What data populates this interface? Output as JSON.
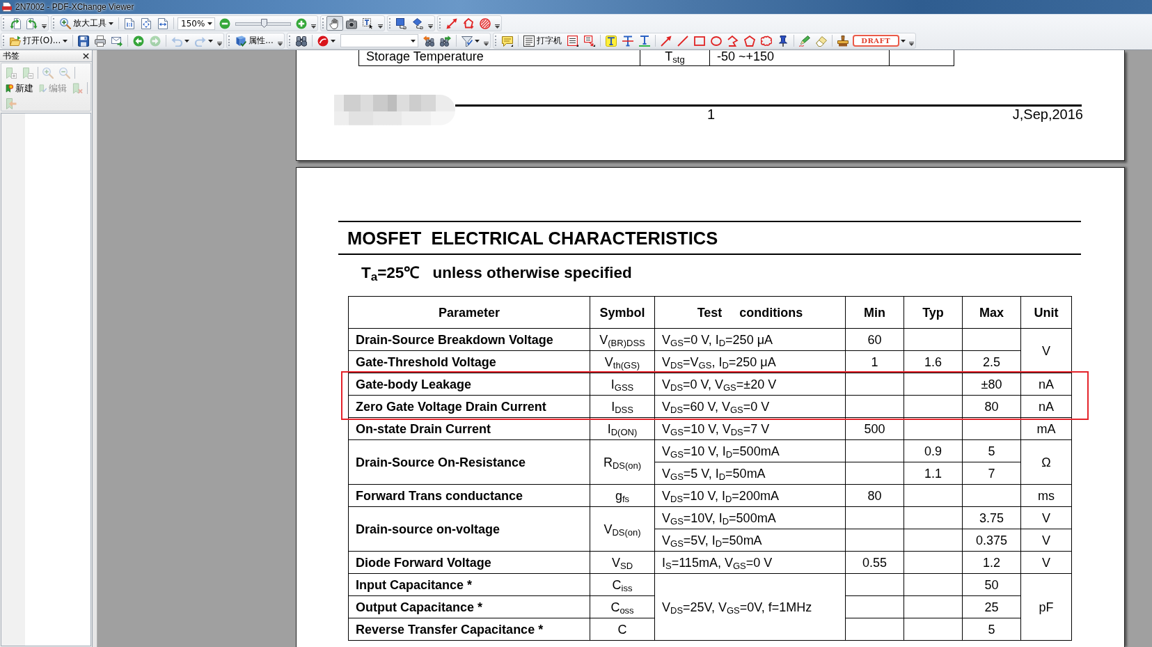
{
  "window": {
    "title": "2N7002 - PDF-XChange Viewer"
  },
  "toolbar_1": {
    "zoom_tool": {
      "label": "放大工具"
    },
    "zoom_box": {
      "value": "150%"
    },
    "zoom_slider": {
      "level": 0.52
    },
    "tools": [
      {
        "selected": true
      },
      {
        "selected": false
      },
      {
        "selected": false
      }
    ]
  },
  "toolbar_2": {
    "open_button": {
      "label": "打开(O)..."
    },
    "history": [
      {
        "disabled": false
      },
      {
        "disabled": true
      },
      {
        "disabled": true
      },
      {
        "disabled": true
      }
    ],
    "properties_button": {
      "label": "属性..."
    },
    "typewriter_button": {
      "label": "打字机"
    },
    "stamp_button": {
      "label": "DRAFT"
    }
  },
  "bookmarks_panel": {
    "title": "书签",
    "tool_buttons": [
      {
        "disabled": true
      },
      {
        "disabled": true
      },
      {
        "disabled": true
      },
      {
        "disabled": true
      }
    ],
    "bookmark_buttons": [
      {
        "label": "新建",
        "disabled": false
      },
      {
        "label": "编辑",
        "disabled": true
      }
    ],
    "extra_buttons": [
      {
        "disabled": true
      },
      {
        "disabled": true
      }
    ]
  },
  "document": {
    "page_1": {
      "table": {
        "rows": [
          {
            "highlighted": false,
            "cells": [
              {
                "kind": "text",
                "text": "Storage Temperature"
              },
              {
                "kind": "text",
                "text": "T$_{stg}$"
              },
              {
                "kind": "text",
                "text": "-50 ~+150"
              },
              {
                "kind": "blank"
              }
            ]
          }
        ]
      },
      "footer": {
        "page_number": "1",
        "date": "J,Sep,2016"
      }
    },
    "page_2": {
      "heading": "MOSFET  ELECTRICAL CHARACTERISTICS",
      "condition": "T$_{a}$=25℃",
      "condition_note": "unless otherwise specified",
      "table": {
        "columns": [
          "Parameter",
          "Symbol",
          "Test     conditions",
          "Min",
          "Typ",
          "Max",
          "Unit"
        ],
        "rows": [
          {
            "highlighted": false,
            "cells": [
              {
                "kind": "text",
                "text": "Drain-Source Breakdown Voltage"
              },
              {
                "kind": "text",
                "text": "V$_{(BR)DSS}$"
              },
              {
                "kind": "text",
                "text": "V$_{GS}$=0 V, I$_{D}$=250 μA"
              },
              {
                "kind": "text",
                "text": "60"
              },
              {
                "kind": "blank"
              },
              {
                "kind": "blank"
              },
              {
                "kind": "text",
                "text": "V",
                "rowspan": 2
              }
            ]
          },
          {
            "highlighted": false,
            "cells": [
              {
                "kind": "text",
                "text": "Gate-Threshold Voltage"
              },
              {
                "kind": "text",
                "text": "V$_{th(GS)}$"
              },
              {
                "kind": "text",
                "text": "V$_{DS}$=V$_{GS}$, I$_{D}$=250 μA"
              },
              {
                "kind": "text",
                "text": "1"
              },
              {
                "kind": "text",
                "text": "1.6"
              },
              {
                "kind": "text",
                "text": "2.5"
              }
            ]
          },
          {
            "highlighted": true,
            "cells": [
              {
                "kind": "text",
                "text": "Gate-body Leakage"
              },
              {
                "kind": "text",
                "text": "I$_{GSS}$"
              },
              {
                "kind": "text",
                "text": "V$_{DS}$=0 V, V$_{GS}$=±20 V"
              },
              {
                "kind": "blank"
              },
              {
                "kind": "blank"
              },
              {
                "kind": "text",
                "text": "±80"
              },
              {
                "kind": "text",
                "text": "nA"
              }
            ]
          },
          {
            "highlighted": true,
            "cells": [
              {
                "kind": "text",
                "text": "Zero Gate Voltage Drain Current"
              },
              {
                "kind": "text",
                "text": "I$_{DSS}$"
              },
              {
                "kind": "text",
                "text": "V$_{DS}$=60 V, V$_{GS}$=0 V"
              },
              {
                "kind": "blank"
              },
              {
                "kind": "blank"
              },
              {
                "kind": "text",
                "text": "80"
              },
              {
                "kind": "text",
                "text": "nA"
              }
            ]
          },
          {
            "highlighted": false,
            "cells": [
              {
                "kind": "text",
                "text": "On-state Drain Current"
              },
              {
                "kind": "text",
                "text": "I$_{D(ON)}$"
              },
              {
                "kind": "text",
                "text": "V$_{GS}$=10 V, V$_{DS}$=7 V"
              },
              {
                "kind": "text",
                "text": "500"
              },
              {
                "kind": "blank"
              },
              {
                "kind": "blank"
              },
              {
                "kind": "text",
                "text": "mA"
              }
            ]
          },
          {
            "highlighted": false,
            "cells": [
              {
                "kind": "text",
                "text": "Drain-Source On-Resistance",
                "rowspan": 2
              },
              {
                "kind": "text",
                "text": "R$_{DS(on)}$",
                "rowspan": 2
              },
              {
                "kind": "text",
                "text": "V$_{GS}$=10 V, I$_{D}$=500mA"
              },
              {
                "kind": "blank"
              },
              {
                "kind": "text",
                "text": "0.9"
              },
              {
                "kind": "text",
                "text": "5"
              },
              {
                "kind": "text",
                "text": "Ω",
                "rowspan": 2
              }
            ]
          },
          {
            "highlighted": false,
            "cells": [
              {
                "kind": "text",
                "text": "V$_{GS}$=5 V, I$_{D}$=50mA"
              },
              {
                "kind": "blank"
              },
              {
                "kind": "text",
                "text": "1.1"
              },
              {
                "kind": "text",
                "text": "7"
              }
            ]
          },
          {
            "highlighted": false,
            "cells": [
              {
                "kind": "text",
                "text": "Forward Trans conductance"
              },
              {
                "kind": "text",
                "text": "g$_{fs}$"
              },
              {
                "kind": "text",
                "text": "V$_{DS}$=10 V, I$_{D}$=200mA"
              },
              {
                "kind": "text",
                "text": "80"
              },
              {
                "kind": "blank"
              },
              {
                "kind": "blank"
              },
              {
                "kind": "text",
                "text": "ms"
              }
            ]
          },
          {
            "highlighted": false,
            "cells": [
              {
                "kind": "text",
                "text": "Drain-source on-voltage",
                "rowspan": 2
              },
              {
                "kind": "text",
                "text": "V$_{DS(on)}$",
                "rowspan": 2
              },
              {
                "kind": "text",
                "text": "V$_{GS}$=10V, I$_{D}$=500mA"
              },
              {
                "kind": "blank"
              },
              {
                "kind": "blank"
              },
              {
                "kind": "text",
                "text": "3.75"
              },
              {
                "kind": "text",
                "text": "V"
              }
            ]
          },
          {
            "highlighted": false,
            "cells": [
              {
                "kind": "text",
                "text": "V$_{GS}$=5V, I$_{D}$=50mA"
              },
              {
                "kind": "blank"
              },
              {
                "kind": "blank"
              },
              {
                "kind": "text",
                "text": "0.375"
              },
              {
                "kind": "text",
                "text": "V"
              }
            ]
          },
          {
            "highlighted": false,
            "cells": [
              {
                "kind": "text",
                "text": "Diode Forward Voltage"
              },
              {
                "kind": "text",
                "text": "V$_{SD}$"
              },
              {
                "kind": "text",
                "text": "I$_{S}$=115mA, V$_{GS}$=0 V"
              },
              {
                "kind": "text",
                "text": "0.55"
              },
              {
                "kind": "blank"
              },
              {
                "kind": "text",
                "text": "1.2"
              },
              {
                "kind": "text",
                "text": "V"
              }
            ]
          },
          {
            "highlighted": false,
            "cells": [
              {
                "kind": "text",
                "text": "Input Capacitance *"
              },
              {
                "kind": "text",
                "text": "C$_{iss}$"
              },
              {
                "kind": "text",
                "text": "V$_{DS}$=25V, V$_{GS}$=0V, f=1MHz",
                "rowspan": 3
              },
              {
                "kind": "blank"
              },
              {
                "kind": "blank"
              },
              {
                "kind": "text",
                "text": "50"
              },
              {
                "kind": "text",
                "text": "pF",
                "rowspan": 3
              }
            ]
          },
          {
            "highlighted": false,
            "cells": [
              {
                "kind": "text",
                "text": "Output Capacitance *"
              },
              {
                "kind": "text",
                "text": "C$_{oss}$"
              },
              {
                "kind": "blank"
              },
              {
                "kind": "blank"
              },
              {
                "kind": "text",
                "text": "25"
              }
            ]
          },
          {
            "highlighted": false,
            "cells": [
              {
                "kind": "text",
                "text": "Reverse Transfer Capacitance *"
              },
              {
                "kind": "text",
                "text": "C"
              },
              {
                "kind": "blank"
              },
              {
                "kind": "blank"
              },
              {
                "kind": "text",
                "text": "5"
              }
            ]
          }
        ]
      }
    }
  }
}
